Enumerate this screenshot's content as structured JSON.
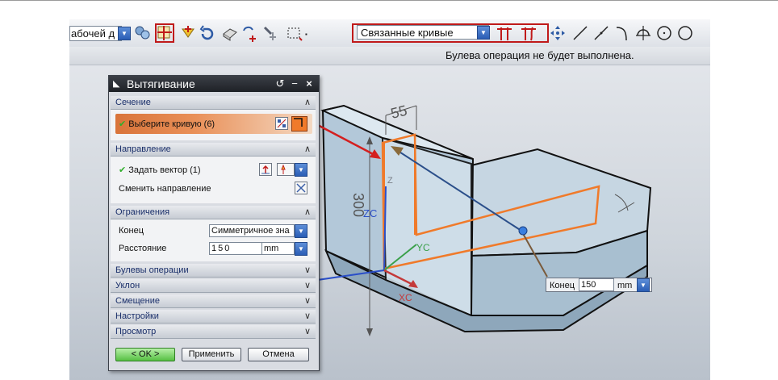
{
  "toolbar": {
    "left_combo_value": "абочей д",
    "main_combo_value": "Связанные кривые"
  },
  "status": {
    "message": "Булева операция не будет выполнена."
  },
  "dialog": {
    "title": "Вытягивание",
    "sections": {
      "section": {
        "header": "Сечение",
        "select_curve_label": "Выберите кривую (6)"
      },
      "direction": {
        "header": "Направление",
        "vector_label": "Задать вектор (1)",
        "reverse_label": "Сменить направление"
      },
      "limits": {
        "header": "Ограничения",
        "end_label": "Конец",
        "end_value": "Симметричное зна",
        "distance_label": "Расстояние",
        "distance_value": "150",
        "distance_unit": "mm"
      },
      "collapsed": [
        {
          "label": "Булевы операции"
        },
        {
          "label": "Уклон"
        },
        {
          "label": "Смещение"
        },
        {
          "label": "Настройки"
        },
        {
          "label": "Просмотр"
        }
      ]
    },
    "buttons": {
      "ok": "< OK >",
      "apply": "Применить",
      "cancel": "Отмена"
    }
  },
  "viewport": {
    "dimension_top": "55",
    "dimension_height": "300",
    "axis_zc": "ZC",
    "axis_yc": "YC",
    "axis_xc": "XC",
    "axis_z_small": "Z",
    "konec_label": "Конец",
    "konec_value": "150",
    "konec_unit": "mm"
  },
  "colors": {
    "highlight_red": "#c01a1a",
    "selection_orange": "#f07a2a",
    "title_bar": "#2a2e35",
    "ok_green": "#56c043"
  }
}
